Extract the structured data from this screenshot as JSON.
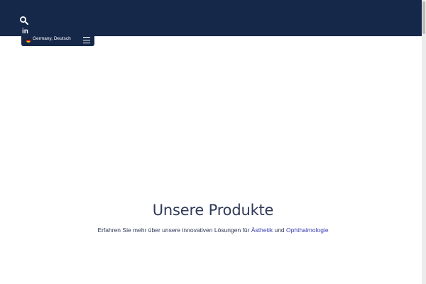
{
  "header": {
    "search_icon": "search-icon",
    "social_icon": "linkedin-icon",
    "social_label": "in",
    "colors": {
      "background": "#16284a",
      "text": "#ffffff"
    }
  },
  "locale": {
    "flag_icon": "germany-flag-icon",
    "label": "Germany, Deutsch",
    "menu_icon": "hamburger-menu-icon"
  },
  "hero": {
    "title": "Unsere Produkte",
    "subtitle_prefix": "Erfahren Sie mehr über unsere innovativen Lösungen für ",
    "link_aesthetics": "Ästhetik",
    "subtitle_middle": " und ",
    "link_ophthalmology": "Ophthalmologie",
    "colors": {
      "title": "#2f3a56",
      "link": "#3a3eb0"
    }
  }
}
